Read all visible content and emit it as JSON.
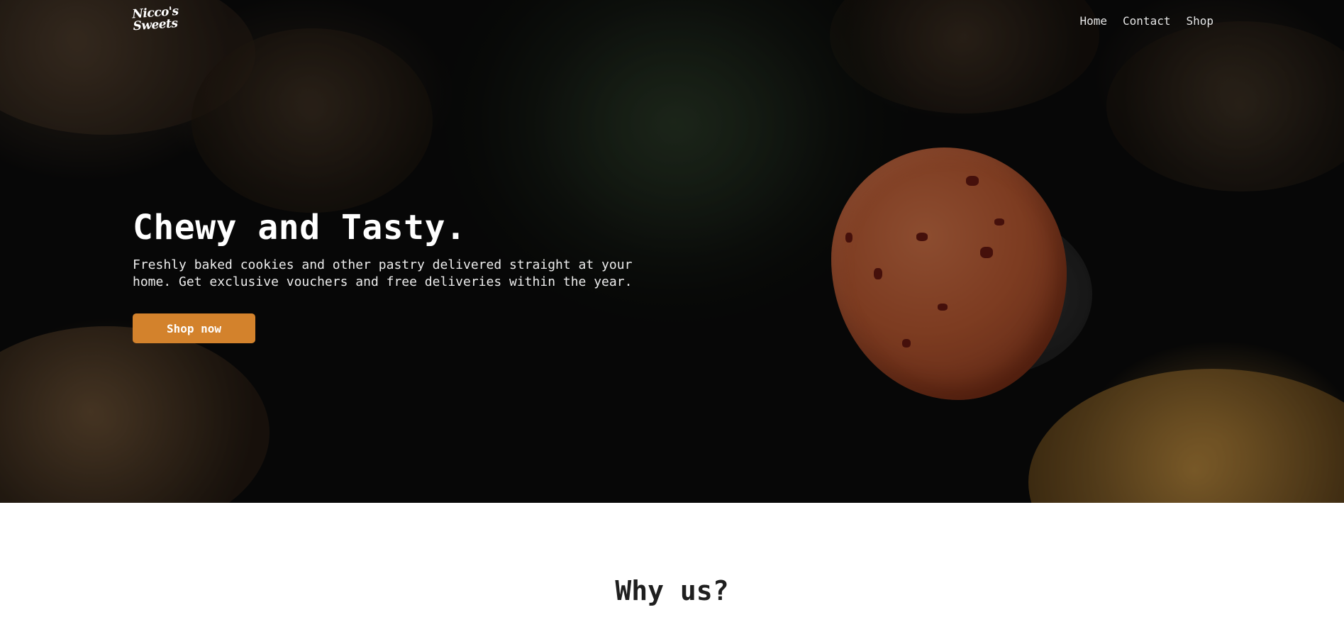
{
  "header": {
    "logo": {
      "line1": "Nicco's",
      "line2": "Sweets"
    },
    "nav": [
      {
        "label": "Home"
      },
      {
        "label": "Contact"
      },
      {
        "label": "Shop"
      }
    ]
  },
  "hero": {
    "title": "Chewy and Tasty.",
    "description": "Freshly baked cookies and other pastry delivered straight at your home. Get exclusive vouchers and free deliveries within the year.",
    "cta_label": "Shop now"
  },
  "why": {
    "title": "Why us?"
  },
  "colors": {
    "accent": "#d3822c",
    "hero_bg": "#0b0b0b",
    "text_light": "#ffffff",
    "text_dark": "#1f1f1f"
  }
}
